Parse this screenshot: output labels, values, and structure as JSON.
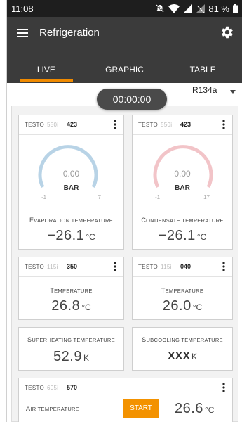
{
  "status_bar": {
    "time": "11:08",
    "battery": "81 %"
  },
  "app_bar": {
    "title": "Refrigeration",
    "menu_icon": "hamburger-menu-icon",
    "settings_icon": "gear-icon"
  },
  "tabs": [
    {
      "label": "LIVE",
      "active": true
    },
    {
      "label": "GRAPHIC",
      "active": false
    },
    {
      "label": "TABLE",
      "active": false
    }
  ],
  "controls": {
    "timer": "00:00:00",
    "refrigerant": "R134a"
  },
  "colors": {
    "accent": "#f08a00",
    "header_bg": "#3b3b3b",
    "gauge_evap": "#b8d3e6",
    "gauge_cond": "#f2c4c8"
  },
  "pressure_cards": [
    {
      "brand": "TESTO",
      "model": "550i",
      "id": "423",
      "gauge_value": "0.00",
      "gauge_unit": "BAR",
      "gauge_min": "-1",
      "gauge_max": "7",
      "label": "Evaporation temperature",
      "value": "−26.1",
      "unit": "°C"
    },
    {
      "brand": "TESTO",
      "model": "550i",
      "id": "423",
      "gauge_value": "0.00",
      "gauge_unit": "BAR",
      "gauge_min": "-1",
      "gauge_max": "17",
      "label": "Condensate temperature",
      "value": "−26.1",
      "unit": "°C"
    }
  ],
  "temp_cards": [
    {
      "brand": "TESTO",
      "model": "115i",
      "id": "350",
      "label": "Temperature",
      "value": "26.8",
      "unit": "°C"
    },
    {
      "brand": "TESTO",
      "model": "115i",
      "id": "040",
      "label": "Temperature",
      "value": "26.0",
      "unit": "°C"
    }
  ],
  "calc_cards": [
    {
      "label": "Superheating temperature",
      "value": "52.9",
      "unit": "K"
    },
    {
      "label": "Subcooling temperature",
      "value": "XXX",
      "unit": "K"
    }
  ],
  "air_card": {
    "brand": "TESTO",
    "model": "605i",
    "id": "570",
    "label": "Air temperature",
    "button": "START",
    "value": "26.6",
    "unit": "°C"
  }
}
